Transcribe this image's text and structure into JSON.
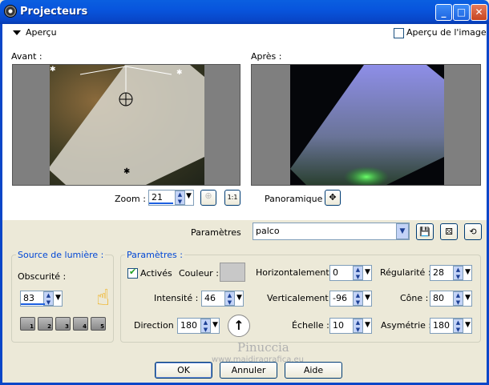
{
  "window": {
    "title": "Projecteurs",
    "minimize": "_",
    "maximize": "□",
    "close": "✕"
  },
  "apercu": {
    "label": "Aperçu",
    "image_preview_label": "Aperçu de l'image"
  },
  "preview": {
    "before_label": "Avant :",
    "after_label": "Après :",
    "zoom_label": "Zoom :",
    "zoom_value": "21",
    "pan_label": "Panoramique :"
  },
  "params": {
    "label": "Paramètres",
    "preset_value": "palco"
  },
  "light_source": {
    "legend": "Source de lumière :",
    "darkness_label": "Obscurité :",
    "darkness_value": "83",
    "presets": [
      "1",
      "2",
      "3",
      "4",
      "5"
    ]
  },
  "parameters": {
    "legend": "Paramètres :",
    "active_label": "Activés",
    "color_label": "Couleur :",
    "color_value": "#c8c8c8",
    "intensity_label": "Intensité :",
    "intensity_value": "46",
    "direction_label": "Direction :",
    "direction_value": "180",
    "horizontal_label": "Horizontalement :",
    "horizontal_value": "0",
    "vertical_label": "Verticalement :",
    "vertical_value": "-96",
    "scale_label": "Échelle :",
    "scale_value": "10",
    "regularity_label": "Régularité :",
    "regularity_value": "28",
    "cone_label": "Cône :",
    "cone_value": "80",
    "asymmetry_label": "Asymétrie :",
    "asymmetry_value": "180"
  },
  "watermark": {
    "line1": "Pinuccia",
    "line2": "www.maidiragrafica.eu"
  },
  "buttons": {
    "ok": "OK",
    "cancel": "Annuler",
    "help": "Aide"
  }
}
